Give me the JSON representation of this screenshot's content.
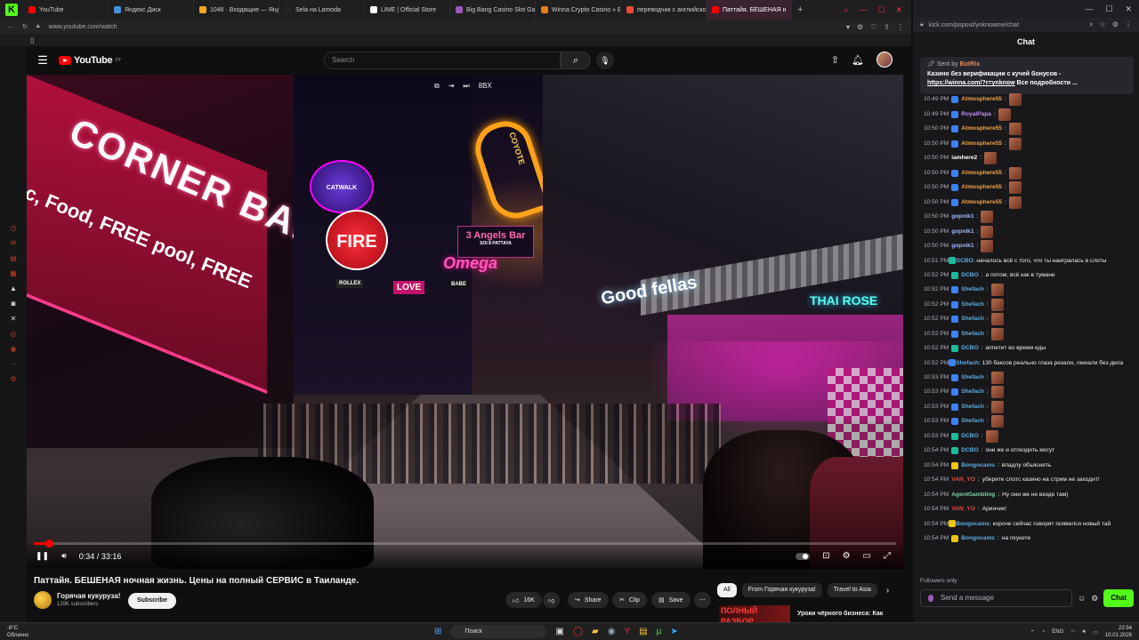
{
  "browser": {
    "tabs": [
      {
        "label": "YouTube",
        "color": "#ff0000"
      },
      {
        "label": "Яндекс Диск",
        "color": "#4a90d9"
      },
      {
        "label": "1046 · Входящие — Янде",
        "color": "#f5a623"
      },
      {
        "label": "Sela на Lamoda",
        "color": "#222222"
      },
      {
        "label": "LIME | Official Store",
        "color": "#ffffff"
      },
      {
        "label": "Big Bang Casino Slot Gam",
        "color": "#9b59b6"
      },
      {
        "label": "Winna Crypto Casino » Be",
        "color": "#e67e22"
      },
      {
        "label": "переводчик с английско",
        "color": "#e74c3c"
      },
      {
        "label": "Паттайя. БЕШЕНАЯ н",
        "color": "#ff0000"
      }
    ],
    "url": "www.youtube.com/watch"
  },
  "youtube": {
    "logo_text": "YouTube",
    "logo_country": "CY",
    "search_placeholder": "Search",
    "video": {
      "signs": {
        "corner_bar": "CORNER BAR",
        "menu_text": "c, Food, FREE pool, FREE",
        "catwalk": "CATWALK",
        "fire": "FIRE",
        "coyote": "COYOTE",
        "three_angels": "3 Angels Bar",
        "soi": "SOI 8 PATTAYA",
        "omega": "Omega",
        "good_fellas": "Good fellas",
        "thai_rose": "THAI ROSE",
        "love": "LOVE",
        "rolex": "ROLLEX",
        "babe": "BABE"
      },
      "quality_badge": "8BX",
      "time_current": "0:34",
      "time_total": "33:16",
      "progress": 0.0172
    },
    "title": "Паттайя. БЕШЕНАЯ ночная жизнь. Цены на полный СЕРВИС в Таиланде.",
    "channel": {
      "name": "Горячая кукуруза!",
      "subscribers": "129K subscribers",
      "subscribe_label": "Subscribe"
    },
    "actions": {
      "likes": "16K",
      "share": "Share",
      "clip": "Clip",
      "save": "Save"
    },
    "chips": [
      "All",
      "From Горячая кукуруза!",
      "Travel to Asia"
    ],
    "recommendation": {
      "thumb_text": "ПОЛНЫЙ РАЗБОР",
      "title": "Уроки чёрного бизнеса: Как"
    }
  },
  "chat": {
    "url": "kick.com/popout/ynknowme/chat",
    "header": "Chat",
    "pinned": {
      "sent_by": "Sent by",
      "bot_name": "BotRix",
      "line1": "Казино без верификации с кучей бонусов -",
      "link": "https://winna.com/?r=ynknow",
      "line2": "Все подробности ..."
    },
    "messages": [
      {
        "time": "10:49 PM",
        "user": "Atmosphere55",
        "color": "#f0a34a",
        "badge": "#3b82f6",
        "text": "",
        "emote": true
      },
      {
        "time": "10:49 PM",
        "user": "RoyalPapa",
        "color": "#c08cf0",
        "badge": "#3b82f6",
        "text": "",
        "emote": true
      },
      {
        "time": "10:50 PM",
        "user": "Atmosphere55",
        "color": "#f0a34a",
        "badge": "#3b82f6",
        "text": "",
        "emote": true
      },
      {
        "time": "10:50 PM",
        "user": "Atmosphere55",
        "color": "#f0a34a",
        "badge": "#3b82f6",
        "text": "",
        "emote": true
      },
      {
        "time": "10:50 PM",
        "user": "iamhere2",
        "color": "#ffffff",
        "badge": "",
        "text": "",
        "emote": true
      },
      {
        "time": "10:50 PM",
        "user": "Atmosphere55",
        "color": "#f0a34a",
        "badge": "#3b82f6",
        "text": "",
        "emote": true
      },
      {
        "time": "10:50 PM",
        "user": "Atmosphere55",
        "color": "#f0a34a",
        "badge": "#3b82f6",
        "text": "",
        "emote": true
      },
      {
        "time": "10:50 PM",
        "user": "Atmosphere55",
        "color": "#f0a34a",
        "badge": "#3b82f6",
        "text": "",
        "emote": true
      },
      {
        "time": "10:50 PM",
        "user": "gopnik1",
        "color": "#9fb8ff",
        "badge": "",
        "text": "",
        "emote": true
      },
      {
        "time": "10:50 PM",
        "user": "gopnik1",
        "color": "#9fb8ff",
        "badge": "",
        "text": "",
        "emote": true
      },
      {
        "time": "10:50 PM",
        "user": "gopnik1",
        "color": "#9fb8ff",
        "badge": "",
        "text": "",
        "emote": true
      },
      {
        "time": "10:51 PM",
        "user": "DCBO",
        "color": "#5dade2",
        "badge": "#1abc9c",
        "text": "началось всё с того, что ты наигралась в слоты",
        "emote": false,
        "wrap": true
      },
      {
        "time": "10:52 PM",
        "user": "DCBO",
        "color": "#5dade2",
        "badge": "#1abc9c",
        "text": "а потом, всё как в тумане",
        "emote": false
      },
      {
        "time": "10:52 PM",
        "user": "Shefach",
        "color": "#5dade2",
        "badge": "#3b82f6",
        "text": "",
        "emote": true
      },
      {
        "time": "10:52 PM",
        "user": "Shefach",
        "color": "#5dade2",
        "badge": "#3b82f6",
        "text": "",
        "emote": true
      },
      {
        "time": "10:52 PM",
        "user": "Shefach",
        "color": "#5dade2",
        "badge": "#3b82f6",
        "text": "",
        "emote": true
      },
      {
        "time": "10:52 PM",
        "user": "Shefach",
        "color": "#5dade2",
        "badge": "#3b82f6",
        "text": "",
        "emote": true
      },
      {
        "time": "10:52 PM",
        "user": "DCBO",
        "color": "#5dade2",
        "badge": "#1abc9c",
        "text": "аппетит во время еды",
        "emote": false
      },
      {
        "time": "10:52 PM",
        "user": "Shefach",
        "color": "#5dade2",
        "badge": "#3b82f6",
        "text": "130 баксов реально глаза резали, леюали без дела",
        "emote": false,
        "wrap": true
      },
      {
        "time": "10:53 PM",
        "user": "Shefach",
        "color": "#5dade2",
        "badge": "#3b82f6",
        "text": "",
        "emote": true
      },
      {
        "time": "10:53 PM",
        "user": "Shefach",
        "color": "#5dade2",
        "badge": "#3b82f6",
        "text": "",
        "emote": true
      },
      {
        "time": "10:53 PM",
        "user": "Shefach",
        "color": "#5dade2",
        "badge": "#3b82f6",
        "text": "",
        "emote": true
      },
      {
        "time": "10:53 PM",
        "user": "Shefach",
        "color": "#5dade2",
        "badge": "#3b82f6",
        "text": "",
        "emote": true
      },
      {
        "time": "10:53 PM",
        "user": "DCBO",
        "color": "#5dade2",
        "badge": "#1abc9c",
        "text": "",
        "emote": true
      },
      {
        "time": "10:54 PM",
        "user": "DCBO",
        "color": "#5dade2",
        "badge": "#1abc9c",
        "text": "они же и отпиздить могут",
        "emote": false
      },
      {
        "time": "10:54 PM",
        "user": "Bongocams",
        "color": "#5dade2",
        "badge": "#f1c40f",
        "text": "впадлу объяснять",
        "emote": false
      },
      {
        "time": "10:54 PM",
        "user": "VAN_YO",
        "color": "#e74c3c",
        "badge": "",
        "text": "уберите слотс казино на стрим не заходит!",
        "emote": false
      },
      {
        "time": "10:54 PM",
        "user": "AgentGambling",
        "color": "#7dcea0",
        "badge": "",
        "text": "Ну они же не везде там)",
        "emote": false
      },
      {
        "time": "10:54 PM",
        "user": "VAN_YO",
        "color": "#e74c3c",
        "badge": "",
        "text": "Аринчик!",
        "emote": false
      },
      {
        "time": "10:54 PM",
        "user": "Bongocams",
        "color": "#5dade2",
        "badge": "#f1c40f",
        "text": "короче сейчас говорят появился новый тай",
        "emote": false,
        "wrap": true
      },
      {
        "time": "10:54 PM",
        "user": "Bongocams",
        "color": "#5dade2",
        "badge": "#f1c40f",
        "text": "на пхукете",
        "emote": false
      }
    ],
    "followers_only": "Followers only",
    "input_placeholder": "Send a message",
    "send_label": "Chat"
  },
  "taskbar": {
    "weather_temp": "-8°C",
    "weather_desc": "Облачно",
    "search_label": "Поиск",
    "lang": "ENG",
    "time": "22:54",
    "date": "10.01.2026"
  }
}
